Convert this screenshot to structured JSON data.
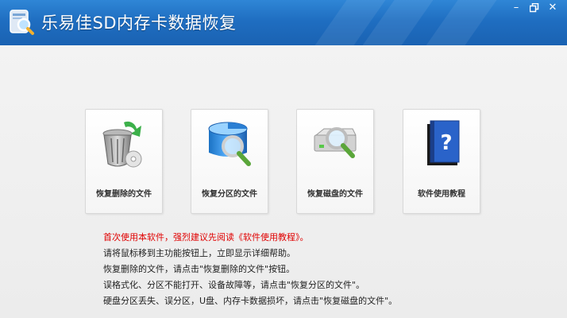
{
  "window": {
    "title": "乐易佳SD内存卡数据恢复",
    "controls": {
      "minimize": "–",
      "restore": "🗗",
      "close": "✕"
    }
  },
  "cards": [
    {
      "label": "恢复删除的文件",
      "icon": "recycle-bin-icon"
    },
    {
      "label": "恢复分区的文件",
      "icon": "partition-magnifier-icon"
    },
    {
      "label": "恢复磁盘的文件",
      "icon": "disk-magnifier-icon"
    },
    {
      "label": "软件使用教程",
      "icon": "help-book-icon"
    }
  ],
  "tips": {
    "warning": "首次使用本软件，强烈建议先阅读《软件使用教程》。",
    "line1": "请将鼠标移到主功能按钮上，立即显示详细帮助。",
    "line2": "恢复删除的文件，请点击\"恢复删除的文件\"按钮。",
    "line3": "误格式化、分区不能打开、设备故障等，请点击\"恢复分区的文件\"。",
    "line4": "硬盘分区丢失、误分区，U盘、内存卡数据损坏，请点击\"恢复磁盘的文件\"。"
  },
  "colors": {
    "titlebar": "#1f6ec1",
    "warning_text": "#e00000"
  }
}
